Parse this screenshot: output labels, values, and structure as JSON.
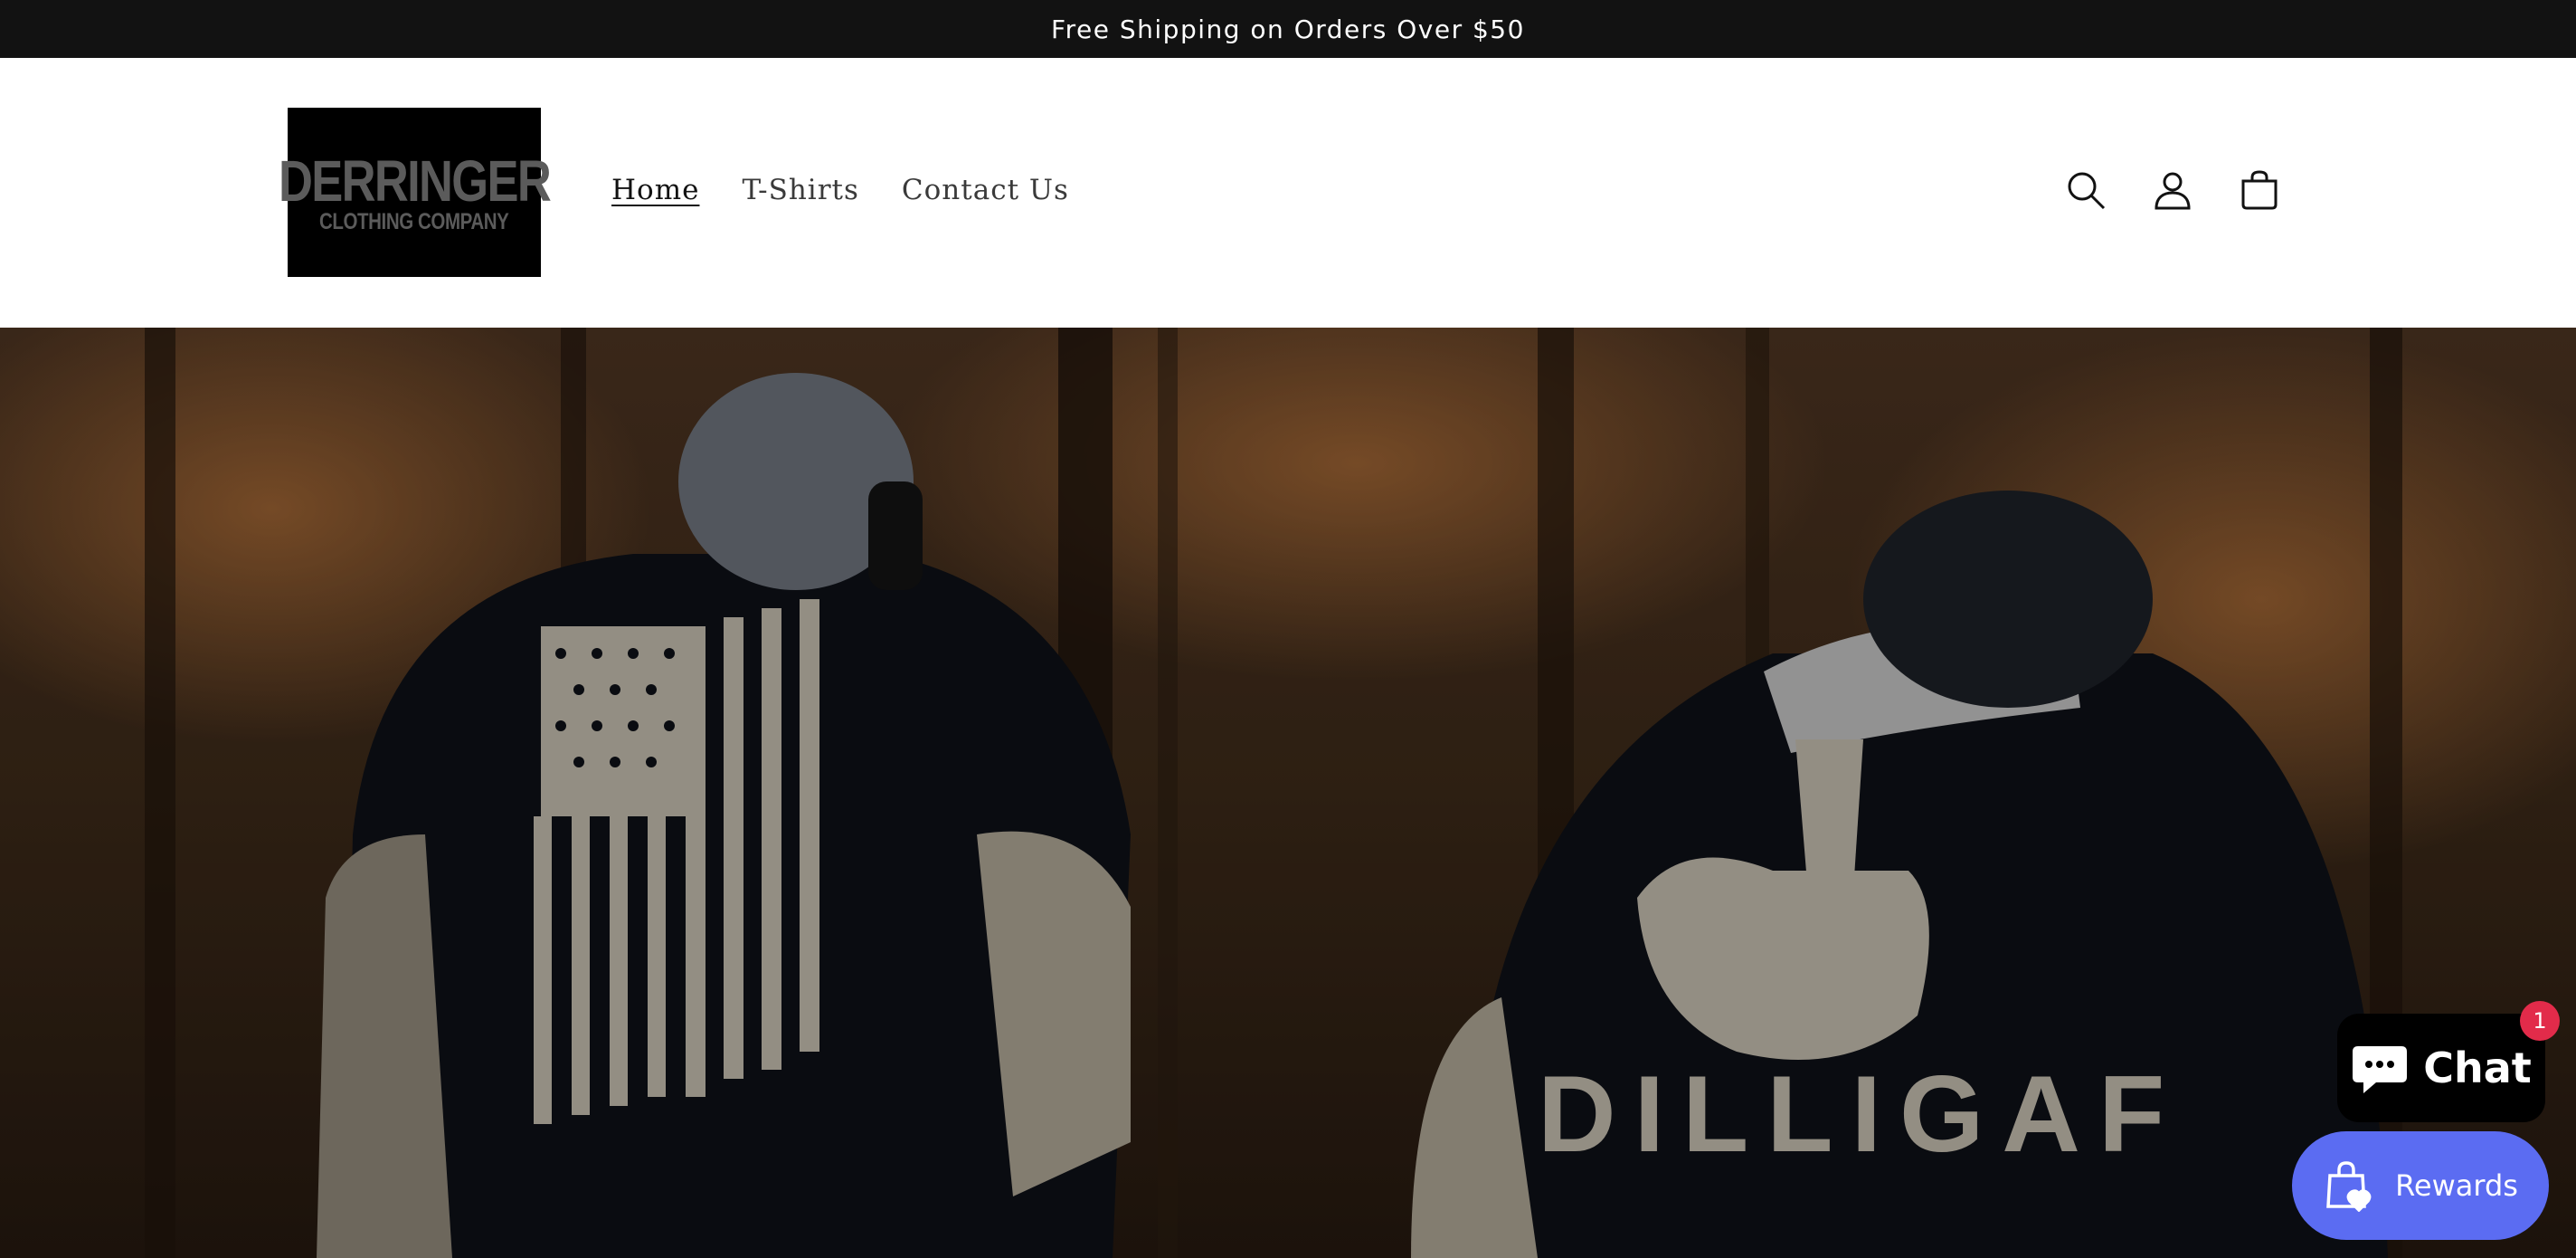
{
  "announcement": {
    "text": "Free Shipping on Orders Over $50"
  },
  "logo": {
    "line1": "DERRINGER",
    "line2": "CLOTHING COMPANY"
  },
  "nav": {
    "items": [
      "Home",
      "T-Shirts",
      "Contact Us"
    ],
    "active": "Home"
  },
  "header_icons": [
    "search-icon",
    "account-icon",
    "cart-icon"
  ],
  "hero": {
    "shirt_left_graphic": "american-flag",
    "shirt_right_text": "DILLIGAF"
  },
  "chat": {
    "label": "Chat",
    "badge": "1"
  },
  "rewards": {
    "label": "Rewards"
  },
  "colors": {
    "announcement_bg": "#121212",
    "chat_bg": "#000000",
    "chat_badge": "#e22b4a",
    "rewards_bg": "#5b6cf2"
  }
}
